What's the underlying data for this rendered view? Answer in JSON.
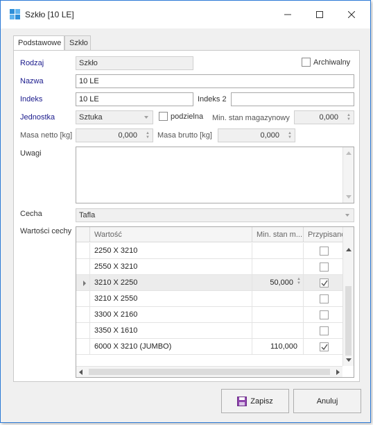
{
  "window": {
    "title": "Szkło [10 LE]"
  },
  "tabs": [
    {
      "label": "Podstawowe",
      "active": true
    },
    {
      "label": "Szkło",
      "active": false
    }
  ],
  "form": {
    "rodzaj_label": "Rodzaj",
    "rodzaj_value": "Szkło",
    "archiwalny_label": "Archiwalny",
    "archiwalny_checked": false,
    "nazwa_label": "Nazwa",
    "nazwa_value": "10 LE",
    "indeks_label": "Indeks",
    "indeks_value": "10 LE",
    "indeks2_label": "Indeks 2",
    "indeks2_value": "",
    "jednostka_label": "Jednostka",
    "jednostka_value": "Sztuka",
    "podzielna_label": "podzielna",
    "podzielna_checked": false,
    "min_stan_label": "Min. stan magazynowy",
    "min_stan_value": "0,000",
    "masa_netto_label": "Masa netto [kg]",
    "masa_netto_value": "0,000",
    "masa_brutto_label": "Masa brutto [kg]",
    "masa_brutto_value": "0,000",
    "uwagi_label": "Uwagi",
    "uwagi_value": "",
    "cecha_label": "Cecha",
    "cecha_value": "Tafla",
    "wartosci_label": "Wartości cechy"
  },
  "grid": {
    "columns": [
      "Wartość",
      "Min. stan m...",
      "Przypisano"
    ],
    "rows": [
      {
        "value": "2250 X 3210",
        "min": "",
        "assigned": false,
        "selected": false
      },
      {
        "value": "2550 X 3210",
        "min": "",
        "assigned": false,
        "selected": false
      },
      {
        "value": "3210 X 2250",
        "min": "50,000",
        "assigned": true,
        "selected": true
      },
      {
        "value": "3210 X 2550",
        "min": "",
        "assigned": false,
        "selected": false
      },
      {
        "value": "3300 X 2160",
        "min": "",
        "assigned": false,
        "selected": false
      },
      {
        "value": "3350 X 1610",
        "min": "",
        "assigned": false,
        "selected": false
      },
      {
        "value": "6000 X 3210 (JUMBO)",
        "min": "110,000",
        "assigned": true,
        "selected": false
      }
    ]
  },
  "buttons": {
    "save_label": "Zapisz",
    "cancel_label": "Anuluj"
  },
  "colors": {
    "required_label": "#1a1a8c",
    "window_border": "#2b79d6",
    "save_icon": "#7b3a9e"
  }
}
